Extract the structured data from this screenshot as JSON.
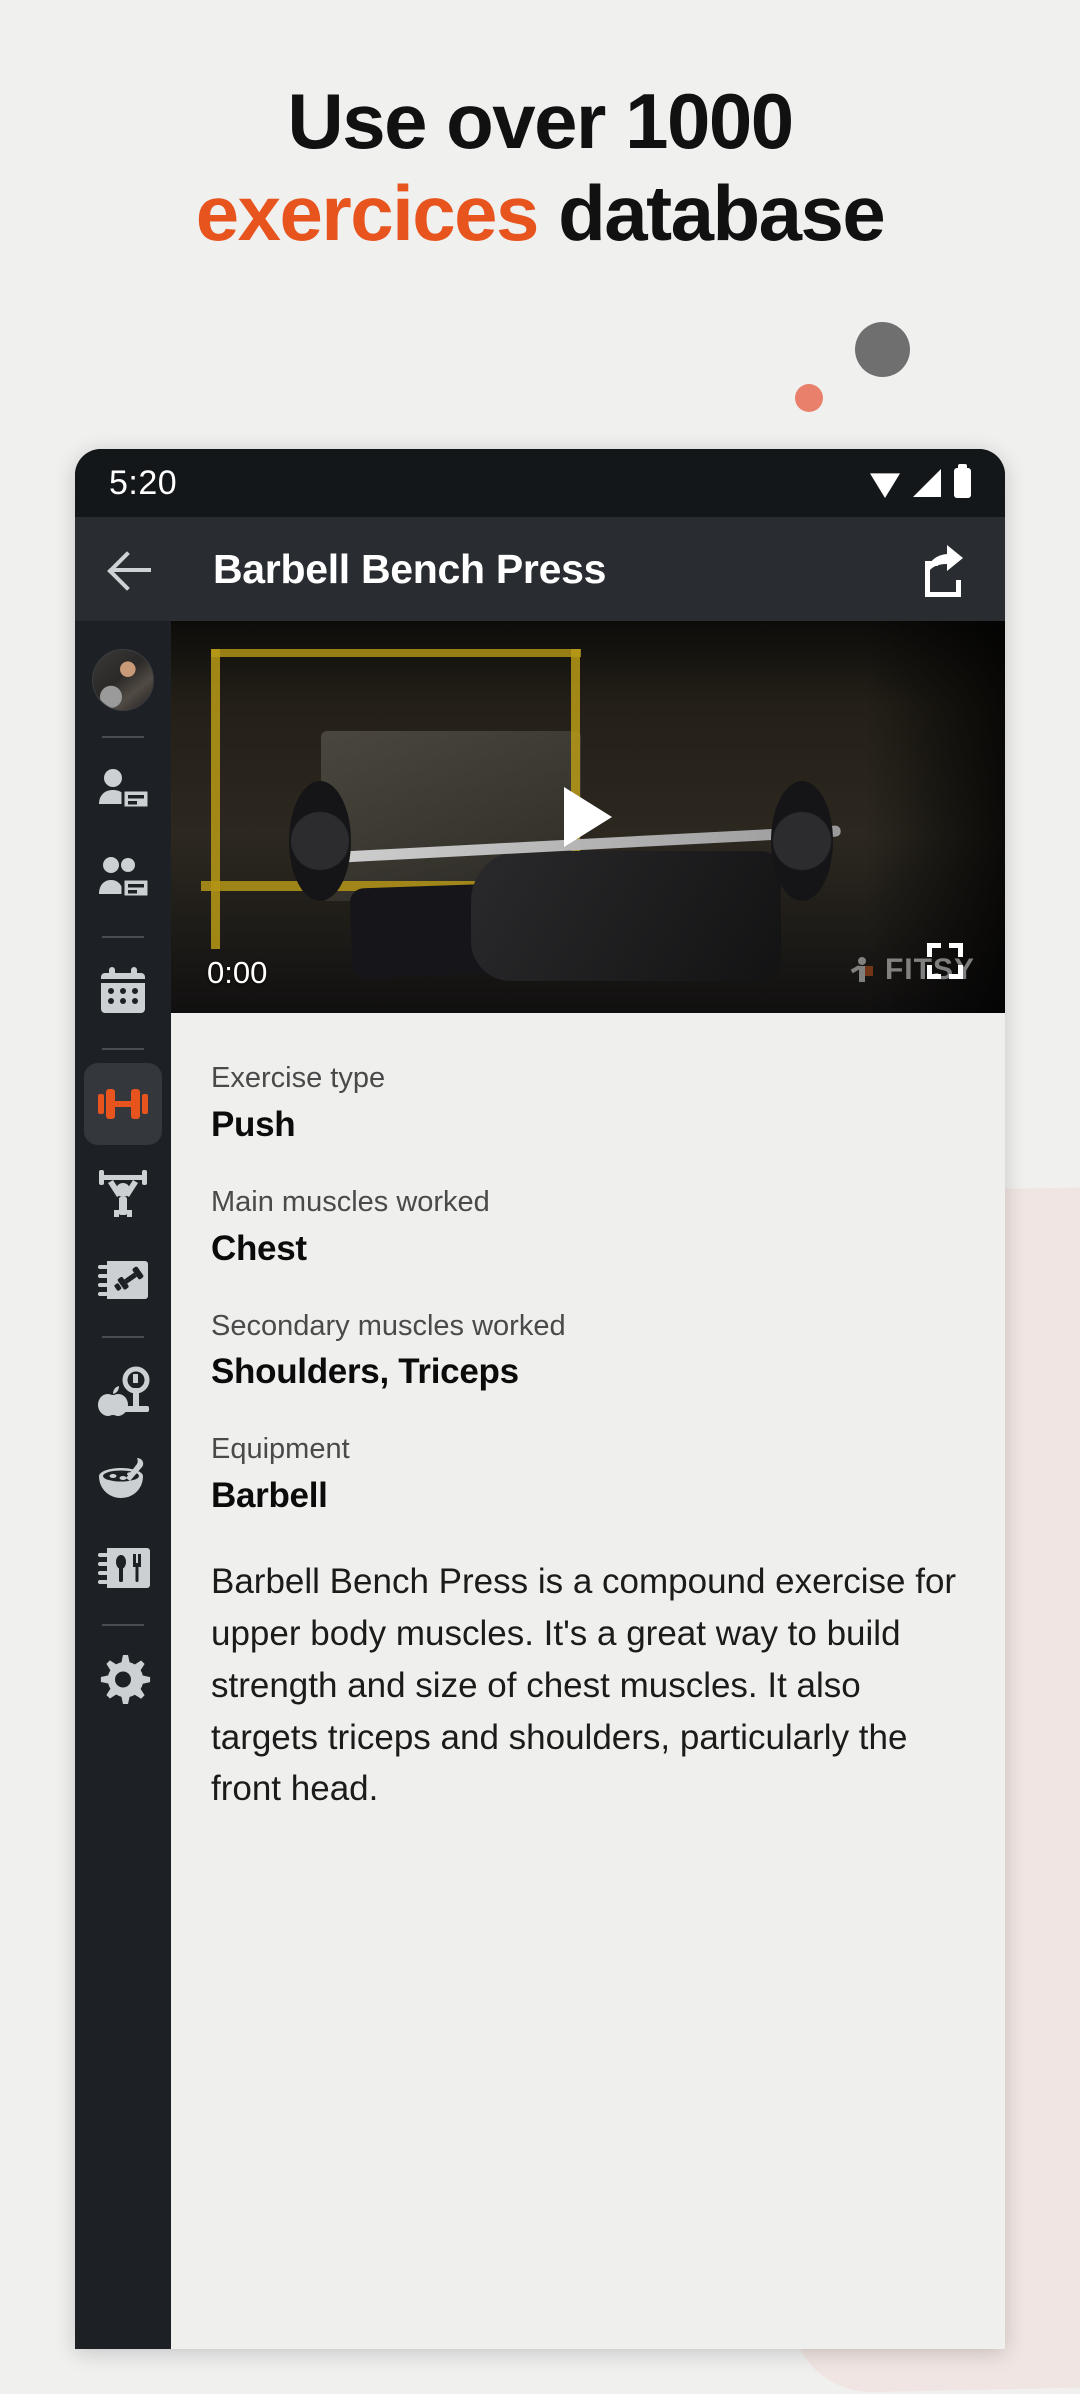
{
  "promo": {
    "headline_line1": "Use over 1000",
    "headline_accent": "exercices",
    "headline_rest": " database",
    "accent_color": "#e8541e",
    "dot_gray_color": "#6f6f6f",
    "dot_salmon_color": "#e9806b",
    "panel_pink_color": "#f0e5e2"
  },
  "statusbar": {
    "time": "5:20",
    "icons": [
      "wifi-icon",
      "signal-icon",
      "battery-icon"
    ]
  },
  "appbar": {
    "back_icon": "back-arrow-icon",
    "title": "Barbell Bench Press",
    "share_icon": "share-icon"
  },
  "rail": {
    "items": [
      {
        "name": "avatar",
        "icon": "user-avatar-photo",
        "active": false
      },
      {
        "name": "clients",
        "icon": "person-card-icon",
        "active": false
      },
      {
        "name": "groups",
        "icon": "group-card-icon",
        "active": false
      },
      {
        "name": "calendar",
        "icon": "calendar-icon",
        "active": false
      },
      {
        "name": "exercises",
        "icon": "dumbbell-icon",
        "active": true
      },
      {
        "name": "workouts",
        "icon": "barbell-lifter-icon",
        "active": false
      },
      {
        "name": "workout-log",
        "icon": "workout-log-icon",
        "active": false
      },
      {
        "name": "nutrition-scale",
        "icon": "scale-apple-icon",
        "active": false
      },
      {
        "name": "recipes",
        "icon": "bowl-spoon-icon",
        "active": false
      },
      {
        "name": "meal-plans",
        "icon": "cutlery-card-icon",
        "active": false
      },
      {
        "name": "settings",
        "icon": "gear-icon",
        "active": false
      }
    ]
  },
  "video": {
    "current_time": "0:00",
    "play_icon": "play-icon",
    "fullscreen_icon": "fullscreen-icon",
    "watermark": "FITSY"
  },
  "details": {
    "fields": [
      {
        "label": "Exercise type",
        "value": "Push"
      },
      {
        "label": "Main muscles worked",
        "value": "Chest"
      },
      {
        "label": "Secondary muscles worked",
        "value": "Shoulders, Triceps"
      },
      {
        "label": "Equipment",
        "value": "Barbell"
      }
    ],
    "description": "Barbell Bench Press is a compound exercise for upper body muscles. It's a great way to build strength and size of chest muscles. It also targets triceps and shoulders, particularly the front head."
  }
}
